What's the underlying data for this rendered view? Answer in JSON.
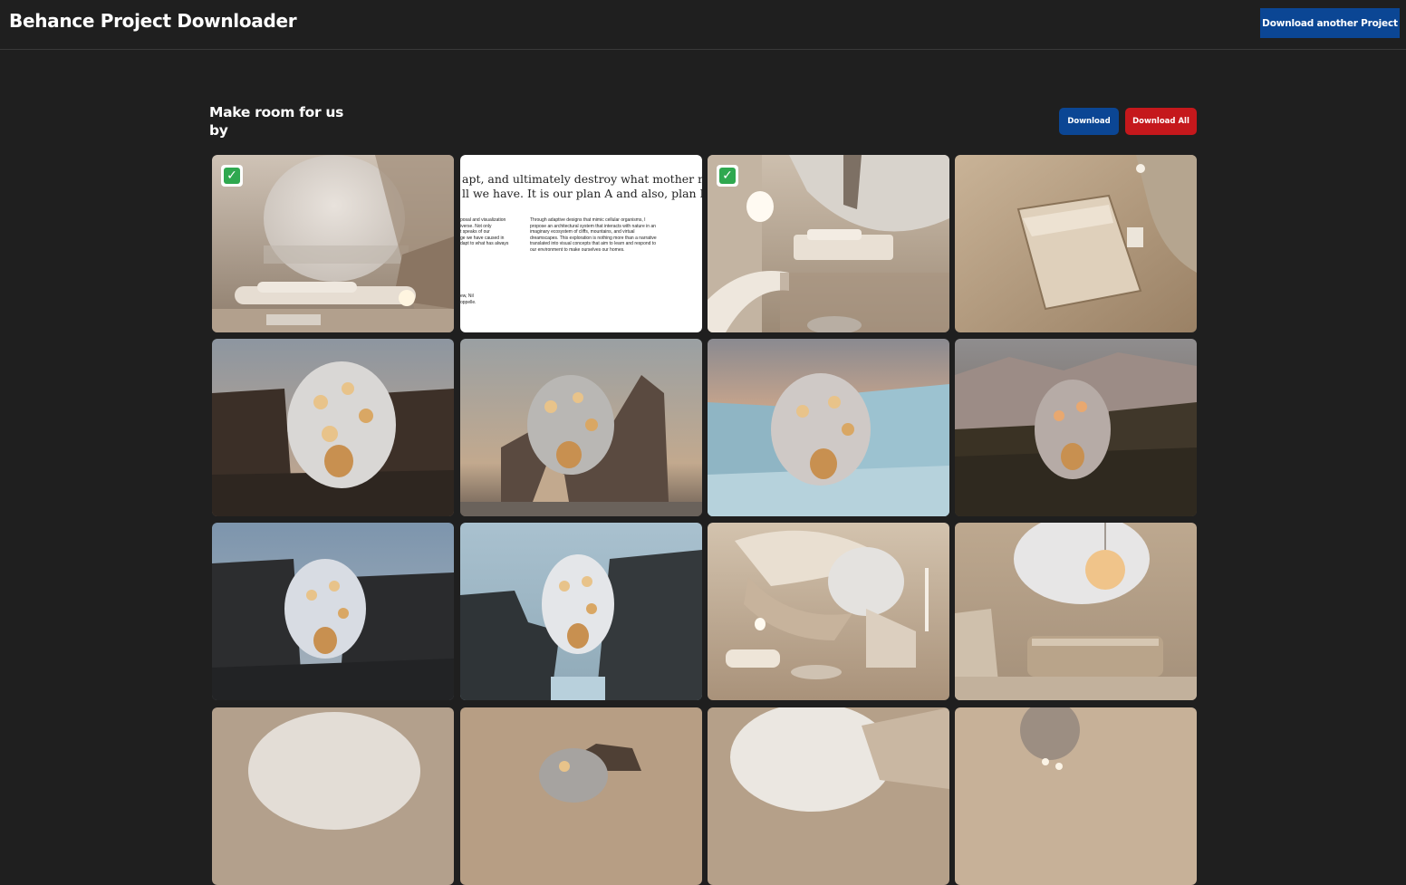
{
  "header": {
    "app_title": "Behance Project Downloader",
    "download_another_label": "Download another Project"
  },
  "project": {
    "title_line1": "Make room for us",
    "title_line2": "by",
    "download_label": "Download",
    "download_all_label": "Download All"
  },
  "document_tile": {
    "heading_line1": "apt, and ultimately destroy what mother nature",
    "heading_line2": "ll we have. It is our plan A and also, plan B.",
    "col1_line1": "posal and visualization",
    "col1_line2": "iverse. Not only",
    "col1_line3": "t speaks of our",
    "col1_line4": "ge we have caused in",
    "col1_line5": "dapt to what has always",
    "col2_line1": "Through adaptive designs that mimic cellular organisms, I",
    "col2_line2": "propose an architectural system that interacts with nature in an",
    "col2_line3": "imaginary ecosystem of cliffs, mountains, and virtual",
    "col2_line4": "dreamscapes. This exploration is nothing more than a narrative",
    "col2_line5": "translated into visual concepts that aim to learn and respond to",
    "col2_line6": "our environment to make ourselves our homes.",
    "foot_line1": "ew, Nil",
    "foot_line2": "oppelle."
  },
  "selection_marker": "✅",
  "images": [
    {
      "scene": "interior-oval-window-living",
      "selected": true
    },
    {
      "scene": "text-document",
      "selected": false
    },
    {
      "scene": "interior-bedroom-sea-view",
      "selected": true
    },
    {
      "scene": "interior-bedroom-topdown",
      "selected": false
    },
    {
      "scene": "pod-dark-cliffs",
      "selected": false
    },
    {
      "scene": "pod-sea-stack",
      "selected": false
    },
    {
      "scene": "pod-ice-glacier",
      "selected": false
    },
    {
      "scene": "pod-forest-cliff",
      "selected": false
    },
    {
      "scene": "pod-dark-rocks-dusk",
      "selected": false
    },
    {
      "scene": "pod-rocks-blue-sky",
      "selected": false
    },
    {
      "scene": "interior-curved-stairs",
      "selected": false
    },
    {
      "scene": "interior-bath-lamp",
      "selected": false
    },
    {
      "scene": "interior-oval-window-2",
      "selected": false
    },
    {
      "scene": "pod-sea-stack-2",
      "selected": false
    },
    {
      "scene": "interior-window-3",
      "selected": false
    },
    {
      "scene": "interior-hanging-lamps",
      "selected": false
    }
  ],
  "colors": {
    "background": "#1f1f1f",
    "primary_blue": "#0b4694",
    "danger_red": "#c5181c",
    "check_green": "#2fa84f"
  }
}
